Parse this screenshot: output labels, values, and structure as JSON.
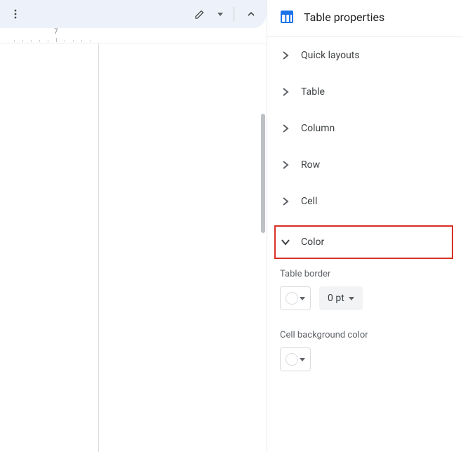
{
  "ruler": {
    "label": "7"
  },
  "panel": {
    "title": "Table properties",
    "sections": {
      "quick_layouts": "Quick layouts",
      "table": "Table",
      "column": "Column",
      "row": "Row",
      "cell": "Cell",
      "color": "Color"
    },
    "color": {
      "border_label": "Table border",
      "border_width": "0 pt",
      "bg_label": "Cell background color"
    }
  }
}
